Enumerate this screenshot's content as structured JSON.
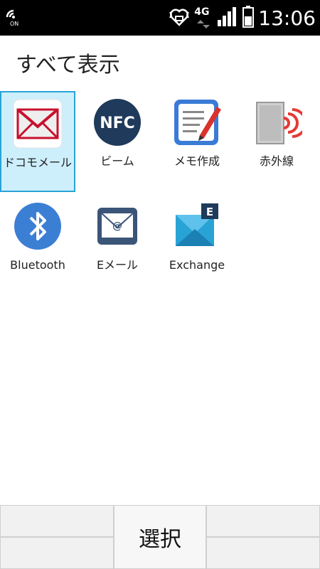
{
  "status_bar": {
    "time": "13:06",
    "network": "4G",
    "left_icon": "wifi-on-icon",
    "icons": [
      "heart-vibrate-icon",
      "signal-arrows-icon",
      "signal-bars-icon",
      "battery-icon"
    ]
  },
  "page": {
    "title": "すべて表示"
  },
  "apps": [
    {
      "label": "ドコモメール",
      "icon": "docomo-mail-icon",
      "selected": true
    },
    {
      "label": "ビーム",
      "icon": "nfc-icon",
      "selected": false
    },
    {
      "label": "メモ作成",
      "icon": "memo-icon",
      "selected": false
    },
    {
      "label": "赤外線",
      "icon": "infrared-icon",
      "selected": false
    },
    {
      "label": "Bluetooth",
      "icon": "bluetooth-icon",
      "selected": false
    },
    {
      "label": "Eメール",
      "icon": "email-icon",
      "selected": false
    },
    {
      "label": "Exchange",
      "icon": "exchange-icon",
      "selected": false
    }
  ],
  "softkeys": {
    "center": "選択"
  },
  "colors": {
    "selected_bg": "#cdeffc",
    "selected_border": "#29a3d6",
    "nfc": "#1f3a5a",
    "bluetooth": "#3b7fd4",
    "mail_red": "#c8102e"
  }
}
